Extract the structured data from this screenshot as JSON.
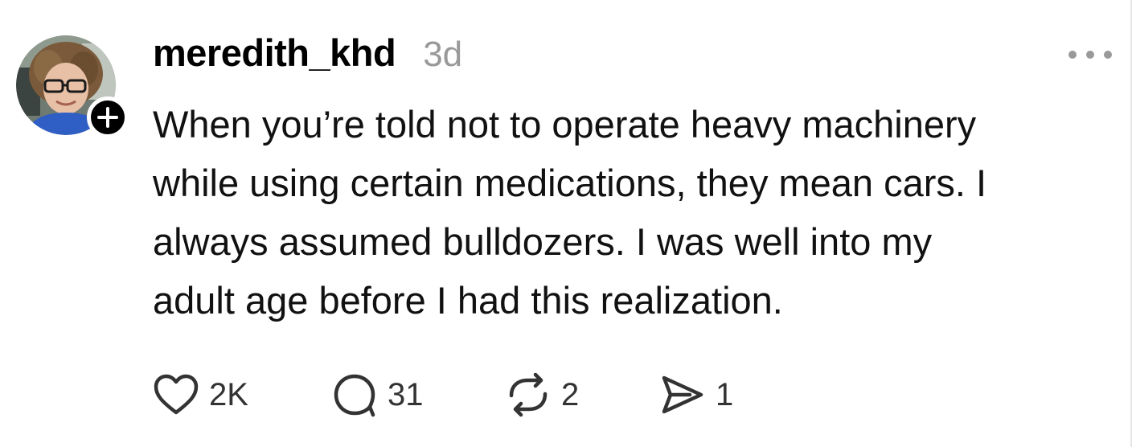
{
  "post": {
    "username": "meredith_khd",
    "timestamp": "3d",
    "text_lines": [
      "When you’re told not to operate heavy machinery",
      "while using certain medications, they mean cars. I",
      "always assumed bulldozers. I was well into my",
      "adult age before I had this realization."
    ],
    "avatar_icon": "user-avatar-photo",
    "follow_icon": "plus-icon",
    "more_icon": "more-horizontal-icon"
  },
  "actions": {
    "like": {
      "icon": "heart-icon",
      "count": "2K"
    },
    "reply": {
      "icon": "comment-icon",
      "count": "31"
    },
    "repost": {
      "icon": "repost-icon",
      "count": "2"
    },
    "share": {
      "icon": "send-icon",
      "count": "1"
    }
  },
  "colors": {
    "text": "#000000",
    "muted": "#999999",
    "icon": "#333333",
    "background": "#ffffff"
  }
}
